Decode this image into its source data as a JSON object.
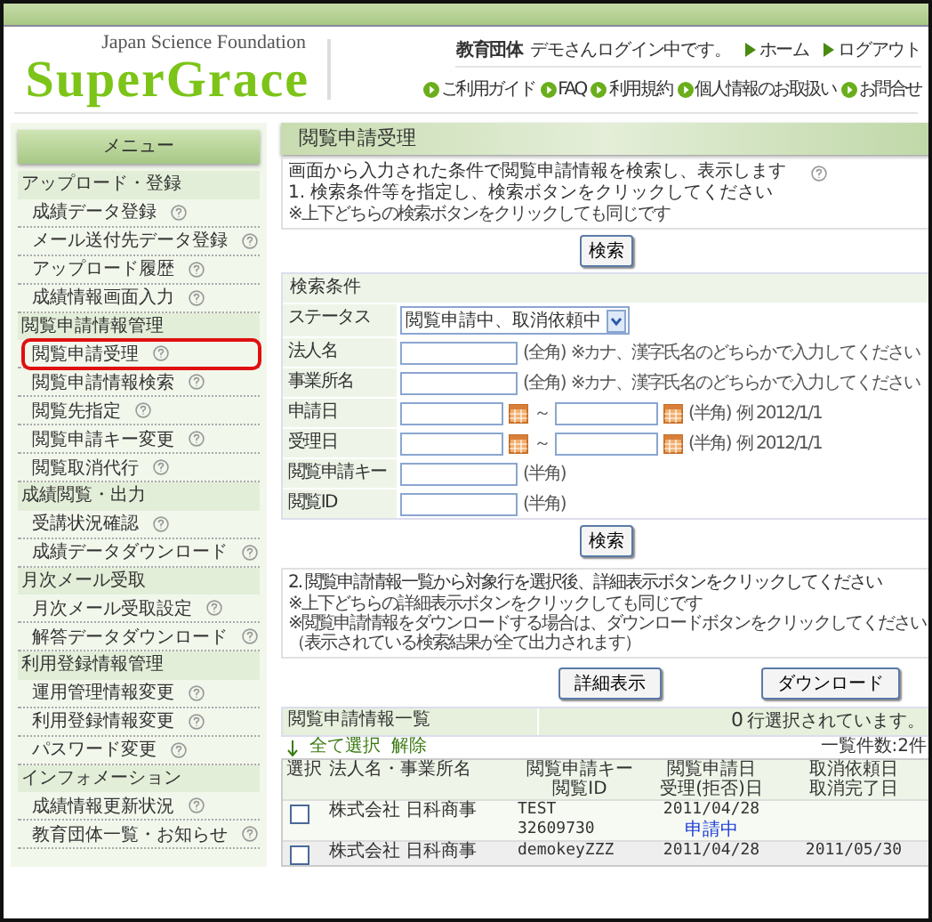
{
  "header": {
    "logo_subtitle": "Japan Science Foundation",
    "logo_title": "SuperGrace",
    "org_label": "教育団体",
    "login_message": "デモさんログイン中です。",
    "nav_links": [
      "ホーム",
      "ログアウト"
    ],
    "help_links": [
      "ご利用ガイド",
      "FAQ",
      "利用規約",
      "個人情報のお取扱い",
      "お問合せ"
    ]
  },
  "sidebar": {
    "title": "メニュー",
    "sections": [
      {
        "label": "アップロード・登録",
        "items": [
          {
            "label": "成績データ登録",
            "selected": false
          },
          {
            "label": "メール送付先データ登録",
            "selected": false
          },
          {
            "label": "アップロード履歴",
            "selected": false
          },
          {
            "label": "成績情報画面入力",
            "selected": false
          }
        ]
      },
      {
        "label": "閲覧申請情報管理",
        "items": [
          {
            "label": "閲覧申請受理",
            "selected": true
          },
          {
            "label": "閲覧申請情報検索",
            "selected": false
          },
          {
            "label": "閲覧先指定",
            "selected": false
          },
          {
            "label": "閲覧申請キー変更",
            "selected": false
          },
          {
            "label": "閲覧取消代行",
            "selected": false
          }
        ]
      },
      {
        "label": "成績閲覧・出力",
        "items": [
          {
            "label": "受講状況確認",
            "selected": false
          },
          {
            "label": "成績データダウンロード",
            "selected": false
          }
        ]
      },
      {
        "label": "月次メール受取",
        "items": [
          {
            "label": "月次メール受取設定",
            "selected": false
          },
          {
            "label": "解答データダウンロード",
            "selected": false
          }
        ]
      },
      {
        "label": "利用登録情報管理",
        "items": [
          {
            "label": "運用管理情報変更",
            "selected": false
          },
          {
            "label": "利用登録情報変更",
            "selected": false
          },
          {
            "label": "パスワード変更",
            "selected": false
          }
        ]
      },
      {
        "label": "インフォメーション",
        "items": [
          {
            "label": "成績情報更新状況",
            "selected": false
          },
          {
            "label": "教育団体一覧・お知らせ",
            "selected": false
          }
        ]
      }
    ]
  },
  "main": {
    "title": "閲覧申請受理",
    "description": [
      {
        "kind": "main",
        "text": "画面から入力された条件で閲覧申請情報を検索し、表示します"
      },
      {
        "kind": "main",
        "text": "1. 検索条件等を指定し、検索ボタンをクリックしてください"
      },
      {
        "kind": "note",
        "text": "※上下どちらの検索ボタンをクリックしても同じです"
      }
    ],
    "search_button_top": "検索",
    "search_panel": {
      "title": "検索条件",
      "fields": [
        {
          "kind": "select",
          "label": "ステータス",
          "value": "閲覧申請中、取消依頼中"
        },
        {
          "kind": "text",
          "label": "法人名",
          "hint": "(全角)",
          "note": "※カナ、漢字氏名のどちらかで入力してください"
        },
        {
          "kind": "text",
          "label": "事業所名",
          "hint": "(全角)",
          "note": "※カナ、漢字氏名のどちらかで入力してください"
        },
        {
          "kind": "date_range",
          "label": "申請日",
          "separator": "～",
          "hint": "(半角)",
          "note": "例 2012/1/1"
        },
        {
          "kind": "date_range",
          "label": "受理日",
          "separator": "～",
          "hint": "(半角)",
          "note": "例 2012/1/1"
        },
        {
          "kind": "text",
          "label": "閲覧申請キー",
          "hint": "(半角)"
        },
        {
          "kind": "text",
          "label": "閲覧ID",
          "hint": "(半角)"
        }
      ]
    },
    "search_button_bottom": "検索",
    "instructions": [
      {
        "kind": "main",
        "text": "2. 閲覧申請情報一覧から対象行を選択後、詳細表示ボタンをクリックしてください"
      },
      {
        "kind": "note",
        "text": "※上下どちらの詳細表示ボタンをクリックしても同じです"
      },
      {
        "kind": "note",
        "text": "※閲覧申請情報をダウンロードする場合は、ダウンロードボタンをクリックしてください"
      },
      {
        "kind": "note",
        "text": "（表示されている検索結果が全て出力されます）"
      }
    ],
    "detail_button": "詳細表示",
    "download_button": "ダウンロード",
    "list": {
      "title": "閲覧申請情報一覧",
      "selected_count": "0",
      "selected_suffix": "行選択されています。",
      "select_all": "全て選択",
      "clear": "解除",
      "count": "一覧件数:2件",
      "columns": [
        [
          "選択"
        ],
        [
          "法人名・事業所名"
        ],
        [
          "閲覧申請キー",
          "閲覧ID"
        ],
        [
          "閲覧申請日",
          "受理(拒否)日"
        ],
        [
          "取消依頼日",
          "取消完了日"
        ]
      ],
      "rows": [
        {
          "checked": false,
          "company": "株式会社 日科商事",
          "key": "TEST",
          "id": "32609730",
          "apply_date": "2011/04/28",
          "status": "申請中",
          "cancel_date": ""
        },
        {
          "checked": false,
          "company": "株式会社 日科商事",
          "key": "demokeyZZZ",
          "id": "",
          "apply_date": "2011/04/28",
          "status": "",
          "cancel_date": "2011/05/30"
        }
      ]
    }
  }
}
